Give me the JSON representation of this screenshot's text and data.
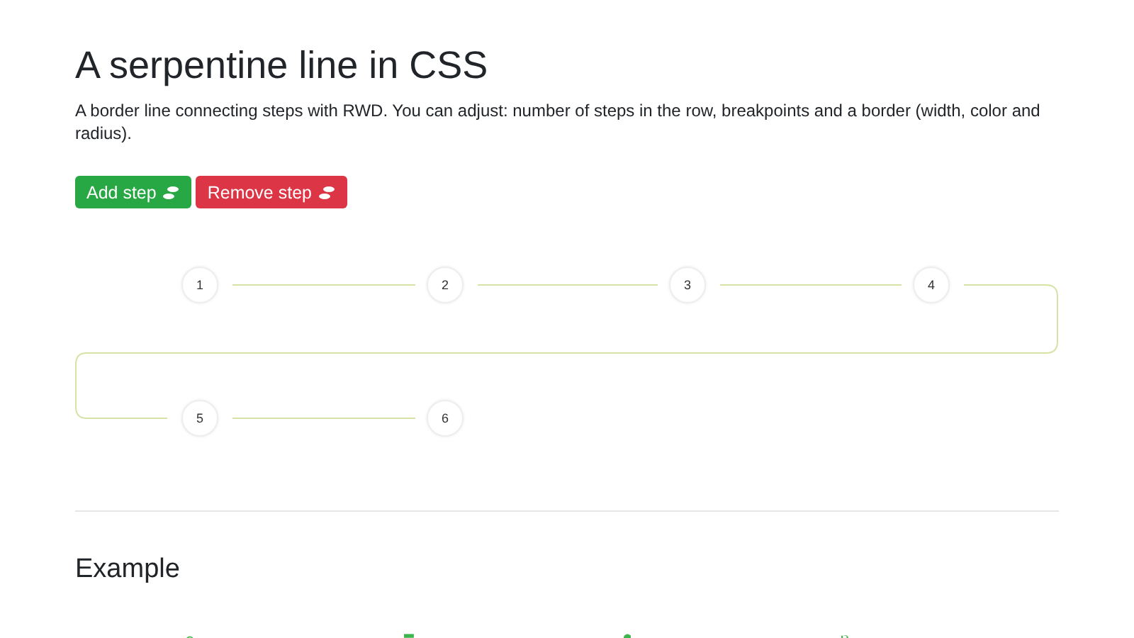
{
  "title": "A serpentine line in CSS",
  "description": "A border line connecting steps with RWD. You can adjust: number of steps in the row, breakpoints and a border (width, color and radius).",
  "buttons": [
    {
      "label": "Add step",
      "kind": "add"
    },
    {
      "label": "Remove step",
      "kind": "remove"
    }
  ],
  "steps": [
    "1",
    "2",
    "3",
    "4",
    "5",
    "6"
  ],
  "example": {
    "heading": "Example"
  }
}
